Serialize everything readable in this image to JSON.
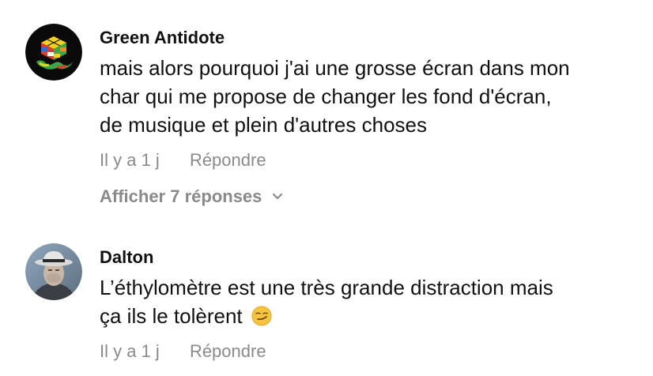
{
  "comments": [
    {
      "author": "Green Antidote",
      "lines": [
        "mais alors pourquoi j'ai une grosse écran dans mon",
        "char qui me propose de changer les fond d'écran,",
        "de musique et plein d'autres choses"
      ],
      "time": "Il y a 1 j",
      "reply_label": "Répondre",
      "replies_toggle": "Afficher 7 réponses",
      "avatar_icon": "melting-rubiks-cube-avatar"
    },
    {
      "author": "Dalton",
      "lines": [
        "L’éthylomètre est une très grande distraction mais",
        "ça ils le tolèrent"
      ],
      "emoji": "smirking-face-emoji",
      "time": "Il y a 1 j",
      "reply_label": "Répondre",
      "avatar_icon": "man-with-hat-avatar"
    }
  ],
  "colors": {
    "text": "#111111",
    "meta": "#8a8a8a",
    "background": "#ffffff"
  }
}
